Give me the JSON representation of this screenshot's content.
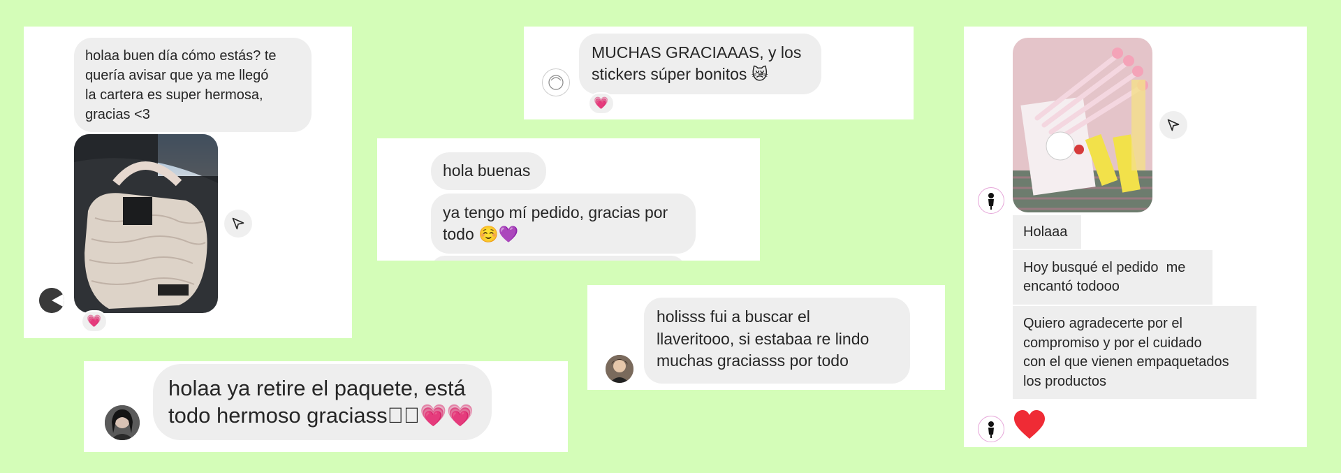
{
  "card1": {
    "message": "holaa buen día cómo estás? te\nquería avisar que ya me llegó\nla cartera es super hermosa,\ngracias <3",
    "photo": "white quilted handbag photo",
    "reaction": "💗"
  },
  "card2": {
    "message": "MUCHAS GRACIAAAS, y los\nstickers súper bonitos 😿",
    "reaction": "💗"
  },
  "card3": {
    "messages": [
      "hola buenas",
      "ya tengo mí pedido, gracias por\ntodo ☺️💜"
    ]
  },
  "card4": {
    "message": "holisss fui a buscar el\nllaveritooo, si estabaa re lindo\nmuchas graciasss por todo"
  },
  "card5": {
    "message": "holaa ya retire el paquete, está\ntodo hermoso graciass�🏻💗💗"
  },
  "card6": {
    "photo": "stationery pens and stickers photo",
    "messages": [
      "Holaaa",
      "Hoy busqué el pedido  me\nencantó todooo",
      "Quiero agradecerte por el\ncompromiso y por el cuidado\ncon el que vienen empaquetados\nlos productos"
    ],
    "reaction": "❤️"
  },
  "colors": {
    "background": "#d4fdb8",
    "bubble": "#eeeeee",
    "card": "#ffffff"
  }
}
